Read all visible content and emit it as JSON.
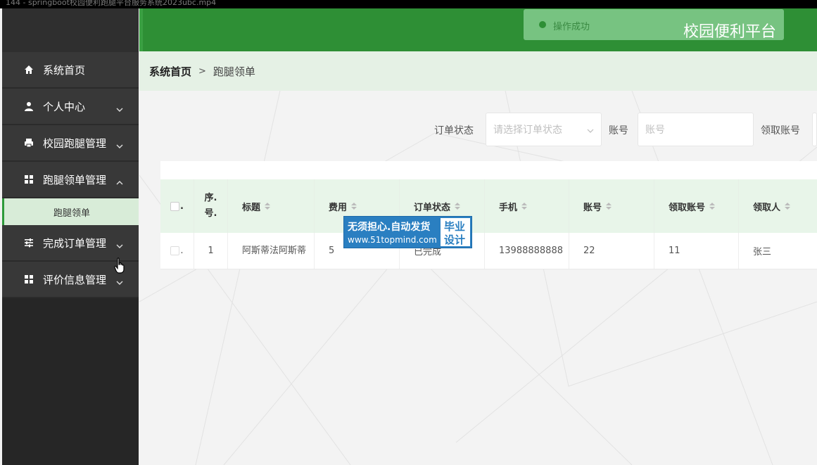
{
  "window": {
    "title": "144 - springboot校园便利跑腿平台服务系统2023ubc.mp4"
  },
  "header": {
    "brand": "校园便利平台",
    "toast": "操作成功"
  },
  "sidebar": {
    "items": [
      {
        "label": "系统首页",
        "icon": "home-icon"
      },
      {
        "label": "个人中心",
        "icon": "user-icon"
      },
      {
        "label": "校园跑腿管理",
        "icon": "printer-icon"
      },
      {
        "label": "跑腿领单管理",
        "icon": "grid-icon"
      },
      {
        "label": "完成订单管理",
        "icon": "sliders-icon"
      },
      {
        "label": "评价信息管理",
        "icon": "grid-icon"
      }
    ],
    "subitem": "跑腿领单"
  },
  "breadcrumb": {
    "home": "系统首页",
    "separator": ">",
    "current": "跑腿领单"
  },
  "search": {
    "status_label": "订单状态",
    "status_placeholder": "请选择订单状态",
    "account_label": "账号",
    "account_placeholder": "账号",
    "receiver_account_label": "领取账号"
  },
  "table": {
    "headers": [
      "序.号.",
      "标题",
      "费用",
      "订单状态",
      "手机",
      "账号",
      "领取账号",
      "领取人"
    ],
    "rows": [
      {
        "index": "1",
        "title": "阿斯蒂法阿斯蒂",
        "fee": "5",
        "status": "已完成",
        "phone": "13988888888",
        "account": "22",
        "receiver_account": "11",
        "receiver": "张三"
      }
    ]
  },
  "watermark": {
    "line1": "无须担心.自动发货",
    "line2": "www.51topmind.com",
    "side1": "毕业",
    "side2": "设计"
  },
  "colors": {
    "brand_green": "#2e8f35",
    "sidebar": "#383838",
    "row_highlight": "#d8ecd8"
  }
}
